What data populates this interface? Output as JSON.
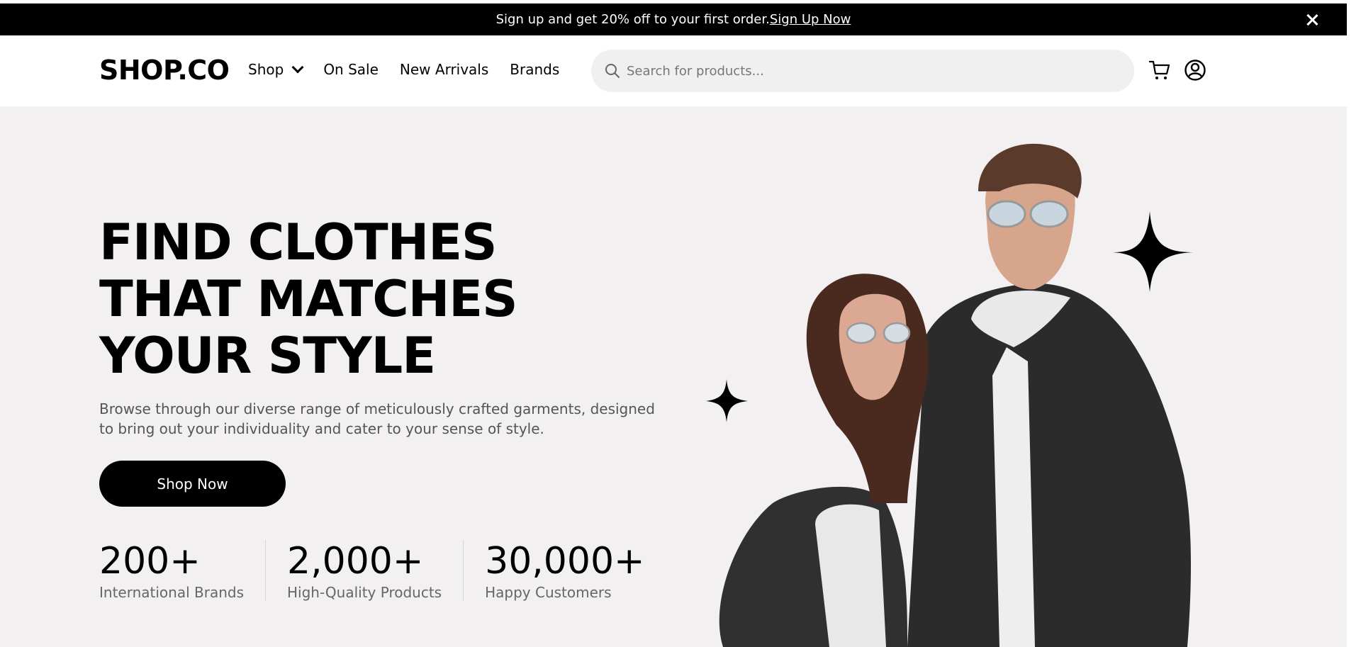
{
  "announcement": {
    "text": "Sign up and get 20% off to your first order.",
    "link": "Sign Up Now"
  },
  "brand": "SHOP.CO",
  "nav": {
    "shop": "Shop",
    "on_sale": "On Sale",
    "new_arrivals": "New Arrivals",
    "brands": "Brands"
  },
  "search": {
    "placeholder": "Search for products..."
  },
  "hero": {
    "headline": [
      "FIND CLOTHES",
      "THAT MATCHES",
      "YOUR STYLE"
    ],
    "description_line1": "Browse through our diverse range of meticulously crafted garments, designed",
    "description_line2": "to bring out your individuality and cater to your sense of style.",
    "cta": "Shop Now",
    "stats": [
      {
        "value": "200+",
        "label": "International Brands"
      },
      {
        "value": "2,000+",
        "label": "High-Quality Products"
      },
      {
        "value": "30,000+",
        "label": "Happy Customers"
      }
    ]
  },
  "colors": {
    "background": "#f2f0f1",
    "bar": "#000000",
    "search_bg": "#f0f0f0"
  },
  "icons": [
    "close-icon",
    "chevron-down-icon",
    "search-icon",
    "cart-icon",
    "account-icon",
    "sparkle-icon"
  ]
}
